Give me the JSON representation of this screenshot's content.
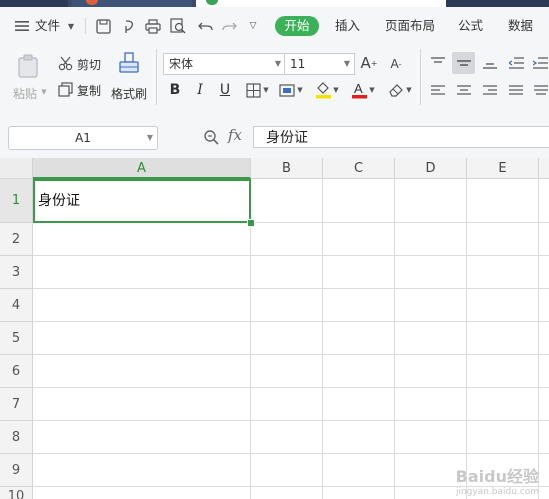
{
  "menu": {
    "file": "文件",
    "tabs": [
      "开始",
      "插入",
      "页面布局",
      "公式",
      "数据"
    ],
    "active_tab": "开始"
  },
  "ribbon": {
    "paste": "粘贴",
    "cut": "剪切",
    "copy": "复制",
    "format_painter": "格式刷",
    "font_name": "宋体",
    "font_size": "11"
  },
  "formula_bar": {
    "cell_ref": "A1",
    "fx": "fx",
    "content": "身份证"
  },
  "sheet": {
    "columns": [
      "A",
      "B",
      "C",
      "D",
      "E"
    ],
    "rows": [
      "1",
      "2",
      "3",
      "4",
      "5",
      "6",
      "7",
      "8",
      "9",
      "10"
    ],
    "cell_a1": "身份证",
    "selected_column": "A",
    "selected_row": "1"
  },
  "watermark": {
    "text": "Baidu经验",
    "sub": "jingyan.baidu.com"
  },
  "colors": {
    "accent": "#3db05a",
    "selection": "#3a9a4a"
  }
}
